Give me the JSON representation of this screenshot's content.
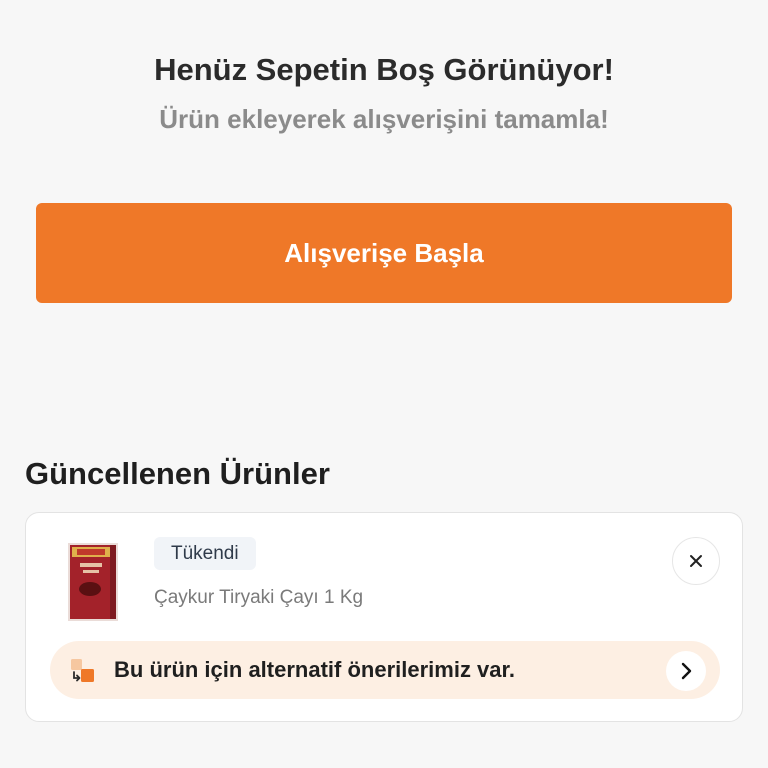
{
  "empty_state": {
    "title": "Henüz Sepetin Boş Görünüyor!",
    "subtitle": "Ürün ekleyerek alışverişini tamamla!",
    "cta_label": "Alışverişe Başla"
  },
  "updated_products": {
    "section_title": "Güncellenen Ürünler",
    "items": [
      {
        "status": "Tükendi",
        "name": "Çaykur Tiryaki Çayı 1 Kg",
        "image_icon": "tea-package-icon",
        "remove_icon": "close-icon",
        "alternative_banner": {
          "text": "Bu ürün için alternatif önerilerimiz var.",
          "icon": "swap-icon",
          "action_icon": "chevron-right-icon"
        }
      }
    ]
  },
  "colors": {
    "accent": "#ef7828",
    "banner_bg": "#fdefe3",
    "badge_bg": "#f1f4f8",
    "title_text": "#2b2b2b",
    "subtitle_text": "#8b8b8b",
    "page_bg": "#f7f7f7"
  }
}
